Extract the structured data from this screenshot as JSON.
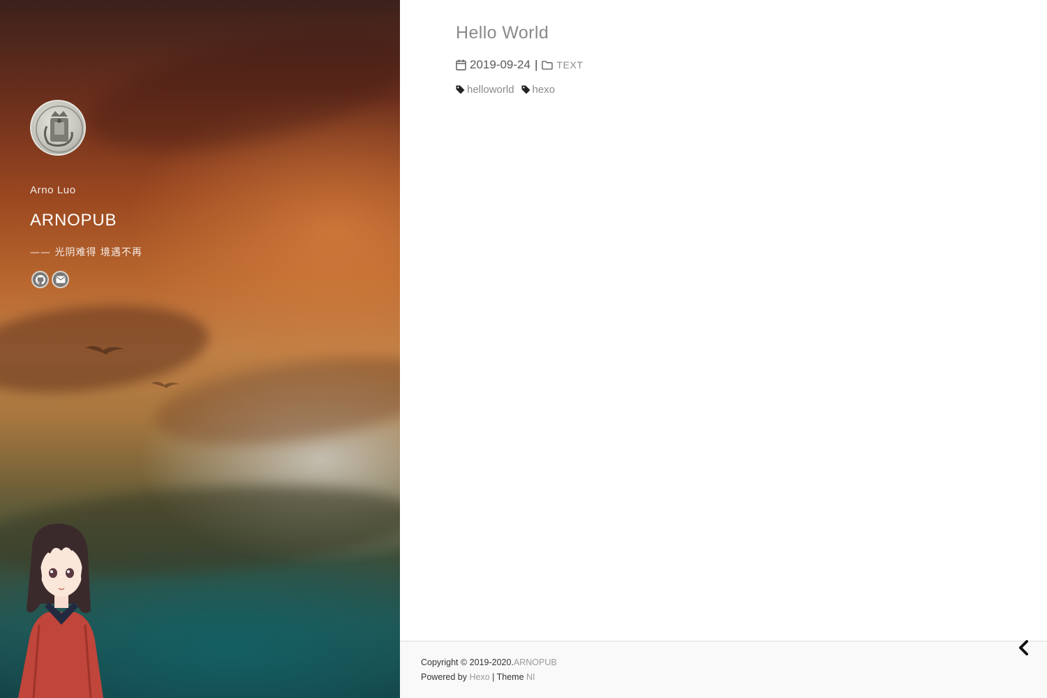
{
  "sidebar": {
    "author": "Arno Luo",
    "site_title": "ARNOPUB",
    "motto": "—— 光阴难得 境遇不再",
    "social": [
      {
        "name": "github",
        "icon": "github-icon"
      },
      {
        "name": "email",
        "icon": "envelope-icon"
      }
    ]
  },
  "post": {
    "title": "Hello World",
    "date": "2019-09-24",
    "separator": "|",
    "category": "TEXT",
    "tags": [
      "helloworld",
      "hexo"
    ],
    "date_icon": "calendar-icon",
    "category_icon": "folder-icon",
    "tag_icon": "tag-icon"
  },
  "footer": {
    "copyright_prefix": "Copyright © 2019-2020.",
    "copyright_link": "ARNOPUB",
    "powered_prefix": "Powered by ",
    "hexo_link": "Hexo",
    "theme_sep": " | Theme ",
    "theme_link": "NI",
    "back_icon": "chevron-left-icon"
  },
  "colors": {
    "link_gray": "#8a8a8a",
    "text_dark": "#333333",
    "footer_bg": "#f9f9f9"
  }
}
